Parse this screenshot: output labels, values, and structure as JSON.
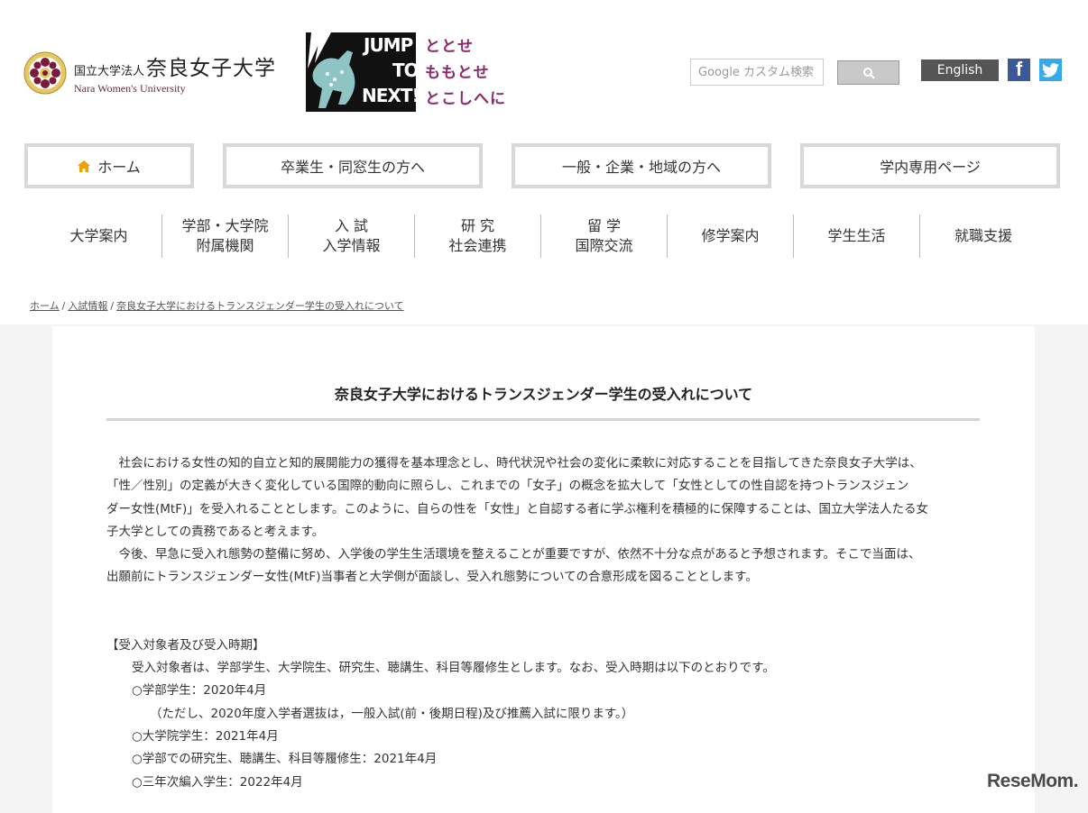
{
  "header": {
    "logo": {
      "corp": "国立大学法人",
      "name": "奈良女子大学",
      "en": "Nara Women's University"
    },
    "banner": {
      "jump_lines": [
        "JUMP",
        "TO",
        "NEXT!!"
      ],
      "phrase_lines": [
        "ととせ",
        "ももとせ",
        "とこしへに"
      ]
    },
    "search": {
      "placeholder": "Google カスタム検索"
    },
    "english_label": "English",
    "social": {
      "facebook": "f"
    }
  },
  "audience_nav": [
    {
      "label": "ホーム"
    },
    {
      "label": "卒業生・同窓生の方へ"
    },
    {
      "label": "一般・企業・地域の方へ"
    },
    {
      "label": "学内専用ページ"
    }
  ],
  "main_nav": [
    {
      "line1": "大学案内",
      "line2": ""
    },
    {
      "line1": "学部・大学院",
      "line2": "附属機関"
    },
    {
      "line1": "入 試",
      "line2": "入学情報"
    },
    {
      "line1": "研 究",
      "line2": "社会連携"
    },
    {
      "line1": "留 学",
      "line2": "国際交流"
    },
    {
      "line1": "修学案内",
      "line2": ""
    },
    {
      "line1": "学生生活",
      "line2": ""
    },
    {
      "line1": "就職支援",
      "line2": ""
    }
  ],
  "breadcrumb": [
    "ホーム",
    "入試情報",
    "奈良女子大学におけるトランスジェンダー学生の受入れについて"
  ],
  "content": {
    "title": "奈良女子大学におけるトランスジェンダー学生の受入れについて",
    "para1_lines": [
      "　社会における女性の知的自立と知的展開能力の獲得を基本理念とし、時代状況や社会の変化に柔軟に対応することを目指してきた奈良女子大学は、",
      "「性／性別」の定義が大きく変化している国際的動向に照らし、これまでの「女子」の概念を拡大して「女性としての性自認を持つトランスジェン",
      "ダー女性(MtF)」を受入れることとします。このように、自らの性を「女性」と自認する者に学ぶ権利を積極的に保障することは、国立大学法人たる女",
      "子大学としての責務であると考えます。"
    ],
    "para2_lines": [
      "　今後、早急に受入れ態勢の整備に努め、入学後の学生生活環境を整えることが重要ですが、依然不十分な点があると予想されます。そこで当面は、",
      "出願前にトランスジェンダー女性(MtF)当事者と大学側が面談し、受入れ態勢についての合意形成を図ることとします。"
    ],
    "section_heading": "【受入対象者及び受入時期】",
    "section_intro": "受入対象者は、学部学生、大学院生、研究生、聴講生、科目等履修生とします。なお、受入時期は以下のとおりです。",
    "schedule": [
      {
        "text": "○学部学生：2020年4月",
        "note": "（ただし、2020年度入学者選抜は，一般入試(前・後期日程)及び推薦入試に限ります。）"
      },
      {
        "text": "○大学院学生：2021年4月",
        "note": ""
      },
      {
        "text": "○学部での研究生、聴講生、科目等履修生：2021年4月",
        "note": ""
      },
      {
        "text": "○三年次編入学生：2022年4月",
        "note": ""
      }
    ]
  },
  "watermark": "ReseMom.",
  "colors": {
    "page_bg": "#f4f4f4",
    "nav_border": "#d8d8d8",
    "english_bg": "#555555",
    "facebook": "#3b5998",
    "twitter": "#35aaeb",
    "banner_text": "#8a2a6a",
    "home_icon": "#f0a000"
  }
}
